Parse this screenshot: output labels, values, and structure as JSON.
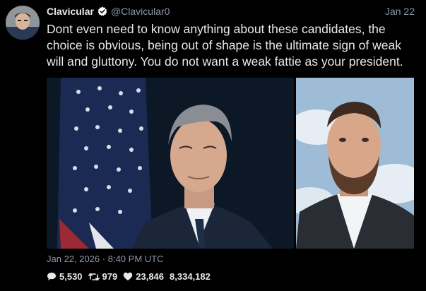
{
  "author": {
    "display_name": "Clavicular",
    "handle": "@Clavicular0",
    "verified": true
  },
  "post": {
    "date": "Jan 22",
    "text": "Dont even need to know anything about these candidates, the choice is obvious, being out of shape is the ultimate sign of weak will and gluttony. You do not want a weak fattie as your president.",
    "timestamp": "Jan 22, 2026 · 8:40 PM UTC"
  },
  "stats": {
    "replies": "5,530",
    "reposts": "979",
    "likes": "23,846",
    "views": "8,334,182"
  },
  "icons": {
    "verified": "verified-badge-icon",
    "replies": "speech-bubble-icon",
    "reposts": "retweet-icon",
    "likes": "heart-icon"
  },
  "colors": {
    "background": "#000000",
    "text": "#e7e9ea",
    "muted": "#8b98a5",
    "verified": "#ffffff"
  }
}
